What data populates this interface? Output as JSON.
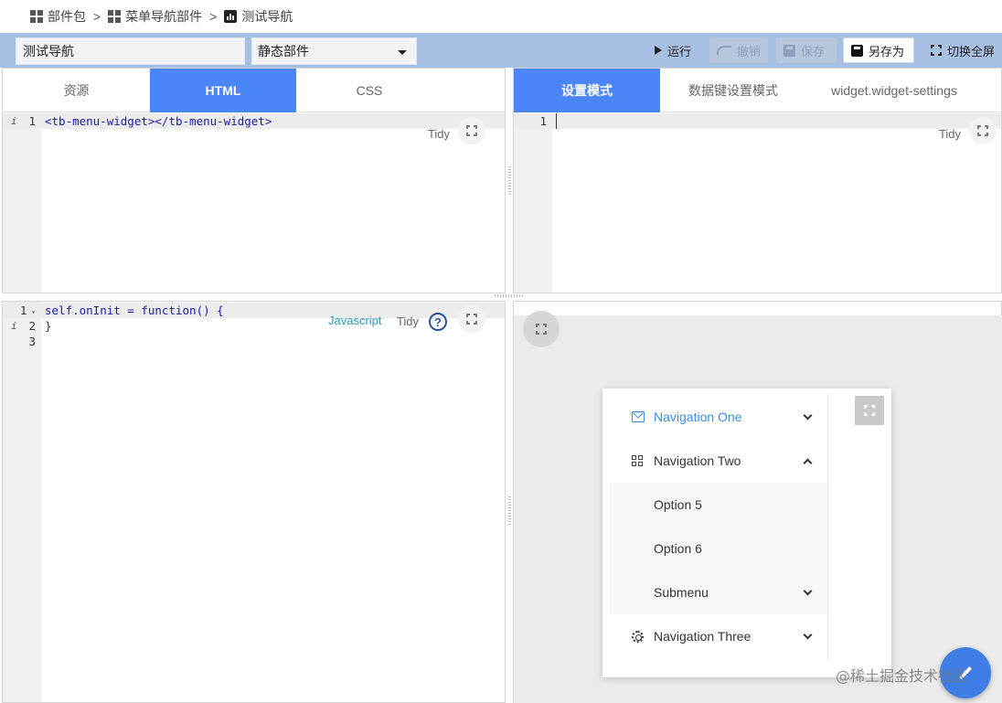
{
  "breadcrumb": {
    "items": [
      "部件包",
      "菜单导航部件",
      "测试导航"
    ],
    "separator": ">"
  },
  "toolbar": {
    "widget_name": "测试导航",
    "widget_type": "静态部件",
    "run_label": "运行",
    "undo_label": "撤销",
    "save_label": "保存",
    "save_as_label": "另存为",
    "fullscreen_label": "切换全屏"
  },
  "left_tabs": [
    "资源",
    "HTML",
    "CSS"
  ],
  "left_active_tab": "HTML",
  "right_tabs": [
    "设置模式",
    "数据键设置模式",
    "widget.widget-settings"
  ],
  "right_active_tab": "设置模式",
  "html_editor": {
    "line_numbers": [
      "1"
    ],
    "lines": [
      "<tb-menu-widget></tb-menu-widget>"
    ],
    "tidy_label": "Tidy"
  },
  "settings_editor": {
    "line_numbers": [
      "1"
    ],
    "tidy_label": "Tidy"
  },
  "js_editor": {
    "line_numbers": [
      "1",
      "2",
      "3"
    ],
    "lines": [
      "self.onInit = function() {",
      "}",
      ""
    ],
    "language_label": "Javascript",
    "tidy_label": "Tidy",
    "help_glyph": "?"
  },
  "preview_menu": {
    "items": [
      {
        "label": "Navigation One",
        "icon": "mail-icon",
        "state": "active"
      },
      {
        "label": "Navigation Two",
        "icon": "appstore-icon",
        "state": "expanded"
      },
      {
        "label": "Option 5",
        "level": 2
      },
      {
        "label": "Option 6",
        "level": 2
      },
      {
        "label": "Submenu",
        "level": 2
      },
      {
        "label": "Navigation Three",
        "icon": "setting-icon"
      }
    ]
  },
  "colors": {
    "accent": "#4a86f7",
    "toolbar_bg": "#a6bfe2",
    "menu_active": "#3a8ee6",
    "fab": "#3e7ce6"
  },
  "watermark": "@稀土掘金技术社区"
}
